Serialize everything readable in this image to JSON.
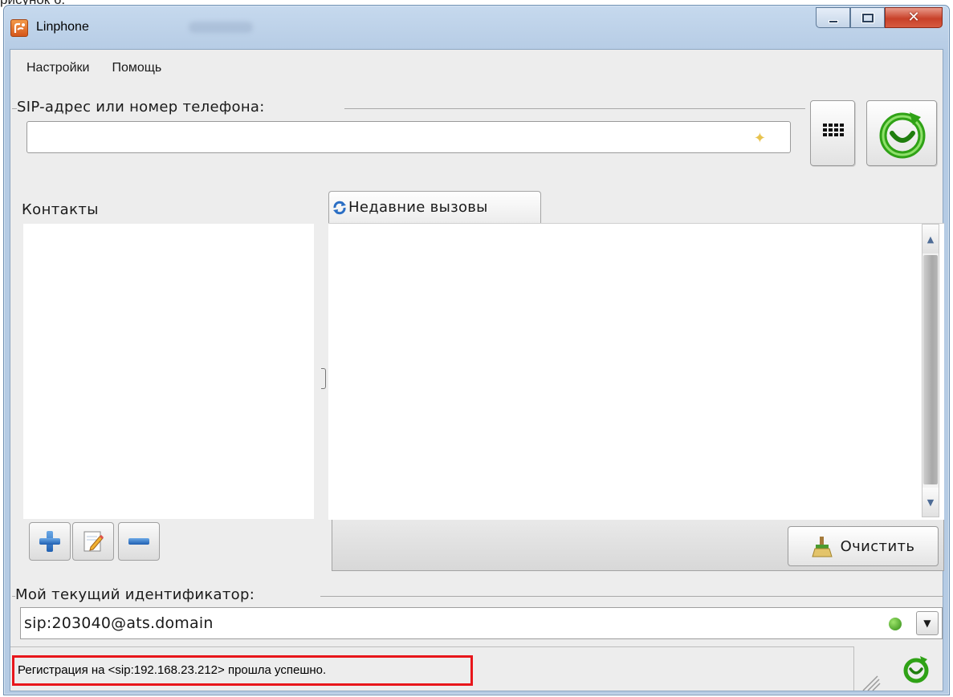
{
  "caption_fragment": "рисунок 6.",
  "window": {
    "title": "Linphone",
    "minimize_label": "",
    "close_glyph": "✕"
  },
  "menu": {
    "settings": "Настройки",
    "help": "Помощь"
  },
  "sip": {
    "group_label": "SIP-адрес или номер телефона:",
    "value": ""
  },
  "contacts": {
    "label": "Контакты",
    "buttons": [
      "add-contact",
      "edit-contact",
      "remove-contact"
    ]
  },
  "recent_calls": {
    "tab_label": "Недавние вызовы",
    "clear_label": "Очистить"
  },
  "identity": {
    "group_label": "Мой текущий идентификатор:",
    "value": "sip:203040@ats.domain",
    "presence_color": "#3fa81e"
  },
  "status": {
    "message": "Регистрация на <sip:192.168.23.212> прошла успешно.",
    "highlight_color": "#e8161b"
  },
  "icons": {
    "app": "linphone-icon",
    "dialpad": "dialpad-icon",
    "call": "call-icon",
    "favorite": "star-icon",
    "refresh": "refresh-icon",
    "broom": "broom-icon"
  }
}
